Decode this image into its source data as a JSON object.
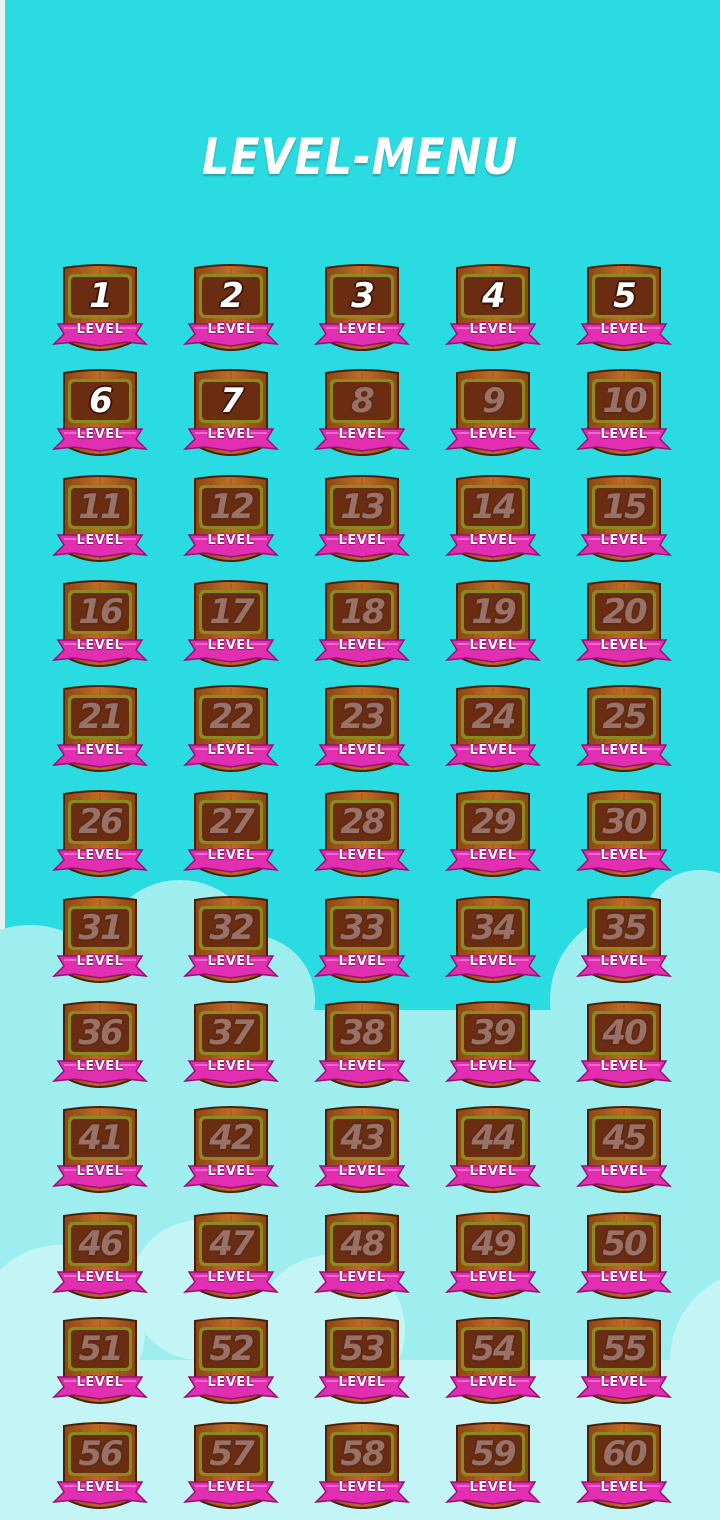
{
  "title": "LEVEL-MENU",
  "level_label": "LEVEL",
  "unlocked_count": 7,
  "levels": [
    "1",
    "2",
    "3",
    "4",
    "5",
    "6",
    "7",
    "8",
    "9",
    "10",
    "11",
    "12",
    "13",
    "14",
    "15",
    "16",
    "17",
    "18",
    "19",
    "20",
    "21",
    "22",
    "23",
    "24",
    "25",
    "26",
    "27",
    "28",
    "29",
    "30",
    "31",
    "32",
    "33",
    "34",
    "35",
    "36",
    "37",
    "38",
    "39",
    "40",
    "41",
    "42",
    "43",
    "44",
    "45",
    "46",
    "47",
    "48",
    "49",
    "50",
    "51",
    "52",
    "53",
    "54",
    "55",
    "56",
    "57",
    "58",
    "59",
    "60"
  ],
  "colors": {
    "background": "#2bdbe2",
    "cloud": "#9eeef0",
    "wood": "#a85a1c",
    "panel": "#6b2d12",
    "ribbon": "#e22fb1",
    "locked_number": "#9a7166",
    "unlocked_number": "#ffffff"
  }
}
